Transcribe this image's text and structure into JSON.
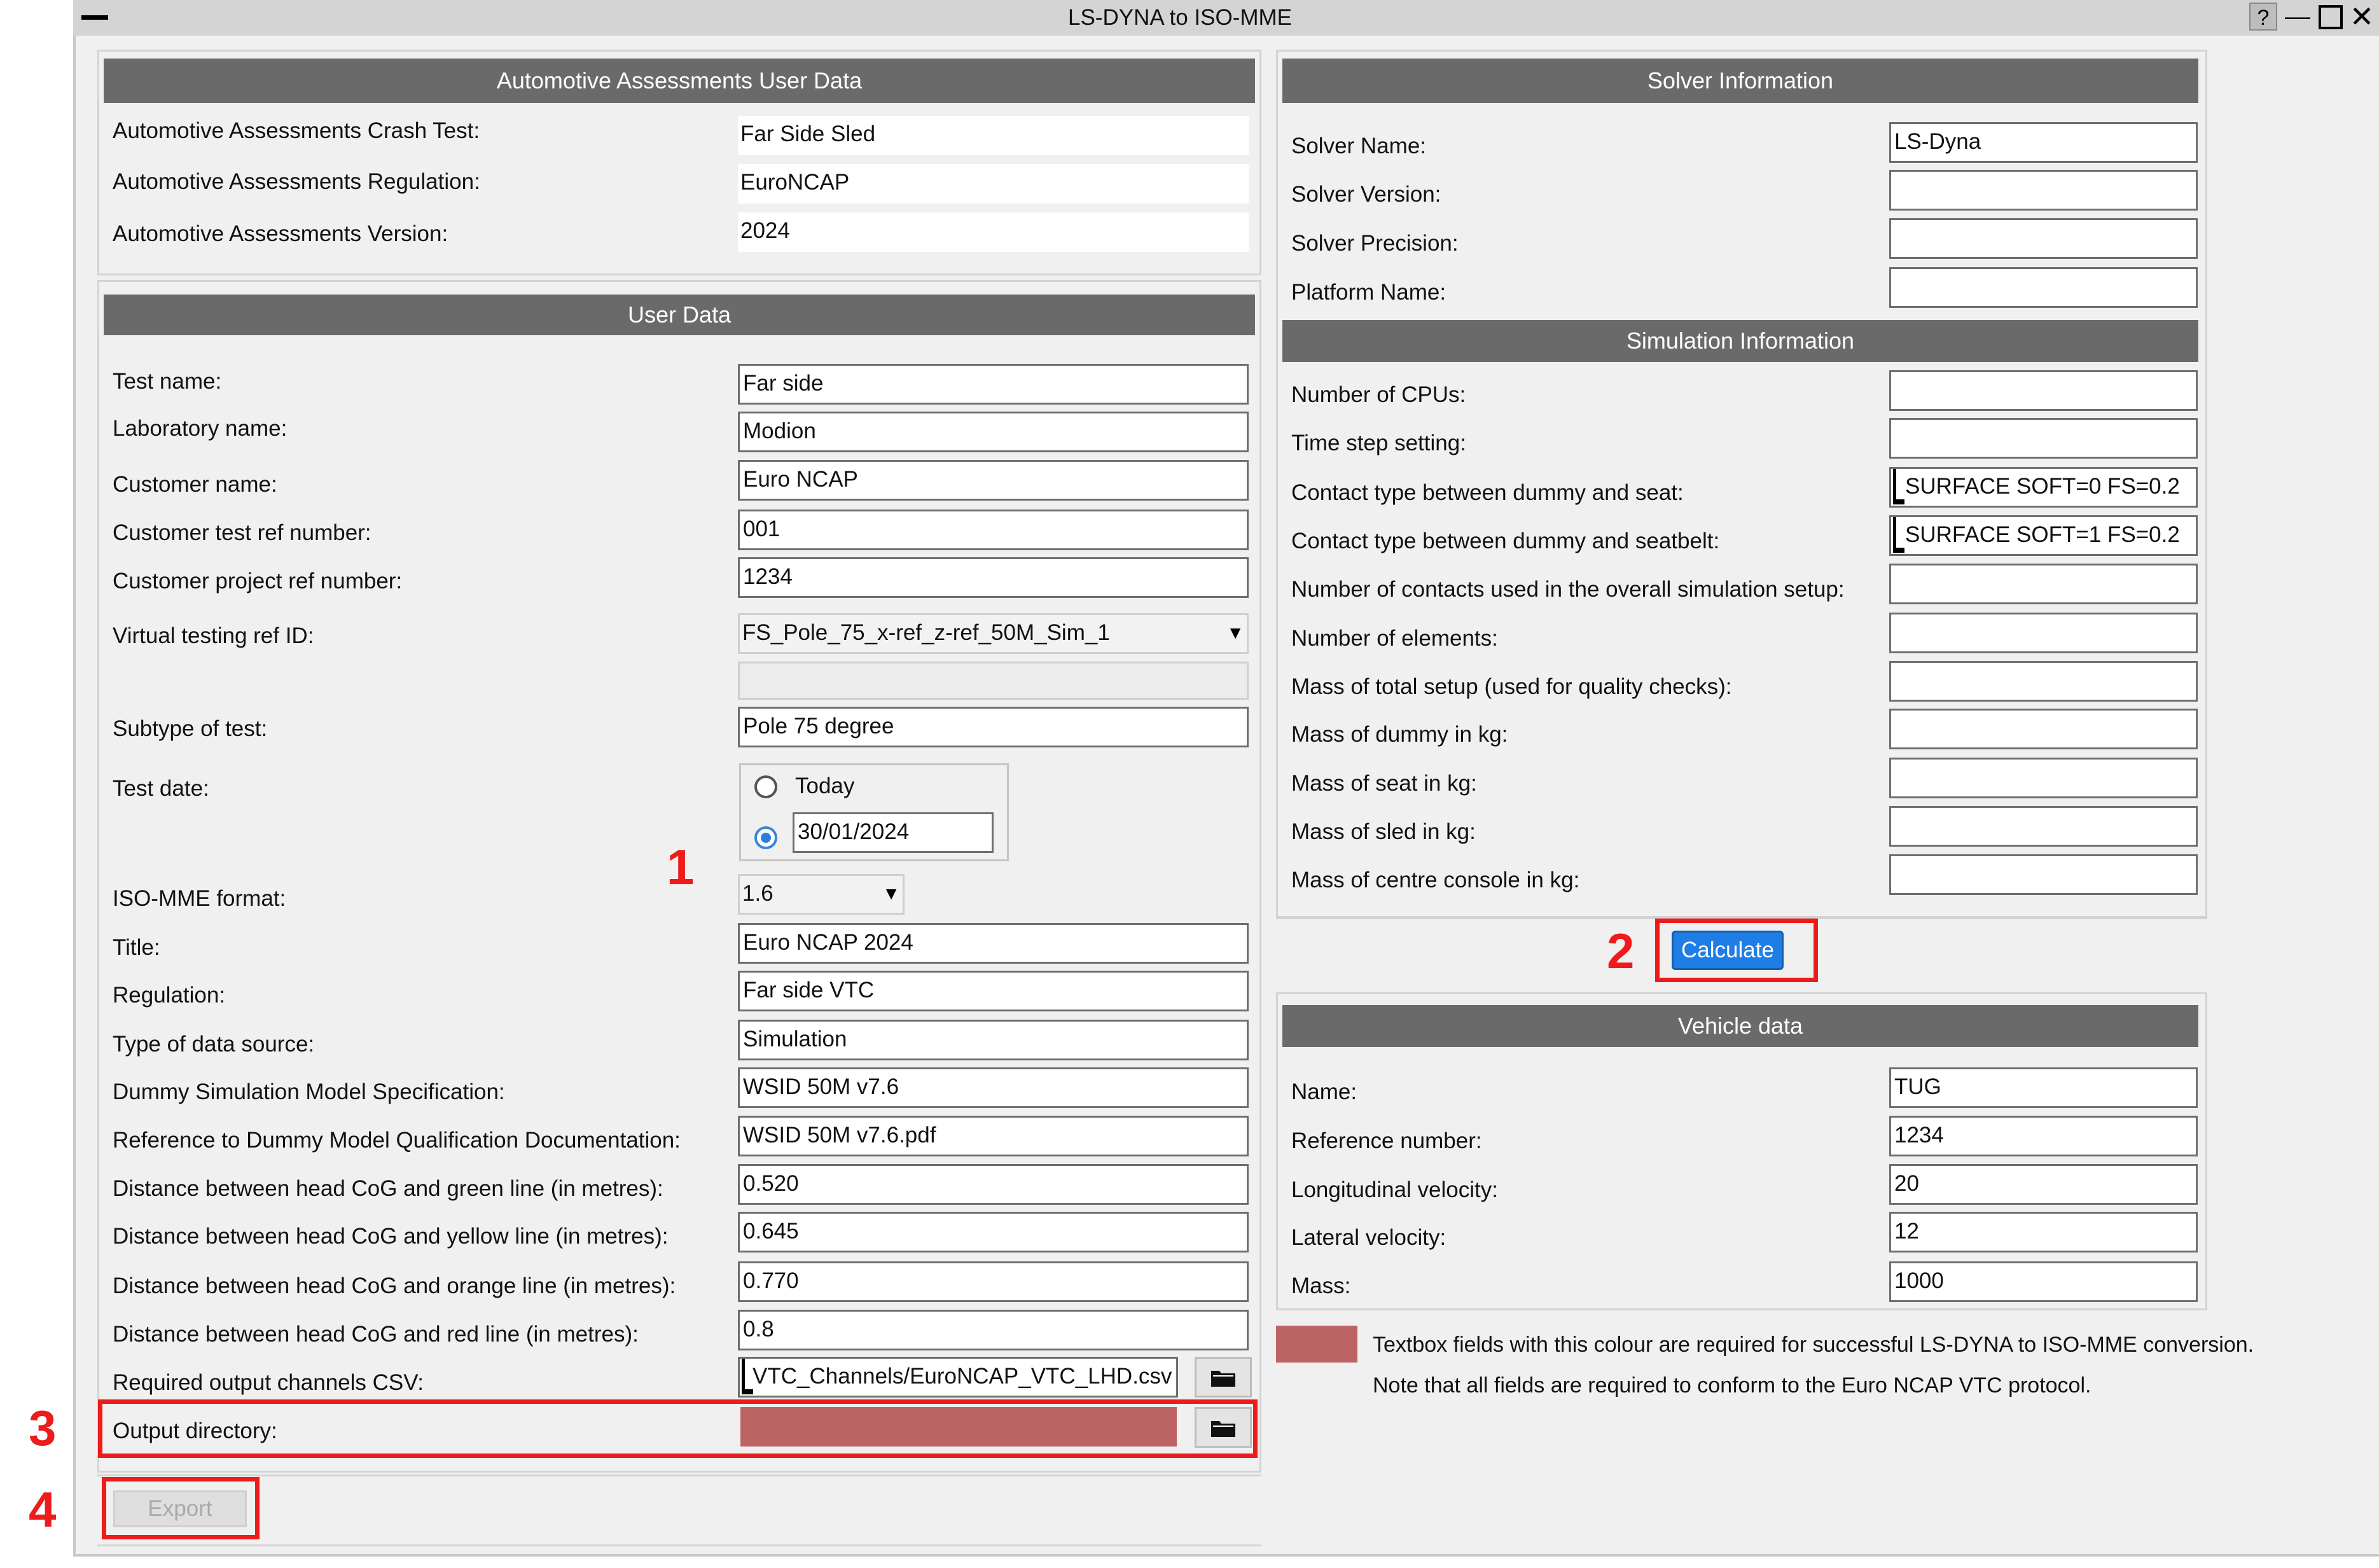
{
  "window": {
    "title": "LS-DYNA to ISO-MME",
    "help_glyph": "?",
    "minimize_glyph": "—",
    "maximize_glyph": "□",
    "close_glyph": "✕"
  },
  "assessments": {
    "header": "Automotive Assessments User Data",
    "crash_test_label": "Automotive Assessments Crash Test:",
    "crash_test_value": "Far Side Sled",
    "regulation_label": "Automotive Assessments Regulation:",
    "regulation_value": "EuroNCAP",
    "version_label": "Automotive Assessments Version:",
    "version_value": "2024"
  },
  "user_data": {
    "header": "User Data",
    "test_name_label": "Test name:",
    "test_name": "Far side",
    "lab_label": "Laboratory name:",
    "lab": "Modion",
    "customer_label": "Customer name:",
    "customer": "Euro NCAP",
    "cust_test_ref_label": "Customer test ref number:",
    "cust_test_ref": "001",
    "cust_proj_ref_label": "Customer project ref number:",
    "cust_proj_ref": "1234",
    "vt_ref_label": "Virtual testing ref ID:",
    "vt_ref": "FS_Pole_75_x-ref_z-ref_50M_Sim_1",
    "subtype_label": "Subtype of test:",
    "subtype": "Pole 75 degree",
    "test_date_label": "Test date:",
    "today_label": "Today",
    "date_value": "30/01/2024",
    "iso_format_label": "ISO-MME format:",
    "iso_format": "1.6",
    "title_label": "Title:",
    "title": "Euro NCAP 2024",
    "regulation_label": "Regulation:",
    "regulation": "Far side VTC",
    "source_label": "Type of data source:",
    "source": "Simulation",
    "dummy_spec_label": "Dummy Simulation Model Specification:",
    "dummy_spec": "WSID 50M v7.6",
    "dummy_doc_label": "Reference to Dummy Model Qualification Documentation:",
    "dummy_doc": "WSID 50M v7.6.pdf",
    "green_label": "Distance between head CoG and green line (in metres):",
    "green": "0.520",
    "yellow_label": "Distance between head CoG and yellow line (in metres):",
    "yellow": "0.645",
    "orange_label": "Distance between head CoG and orange line (in metres):",
    "orange": "0.770",
    "red_label": "Distance between head CoG and red line (in metres):",
    "red": "0.8",
    "channels_label": "Required output channels CSV:",
    "channels": "VTC_Channels/EuroNCAP_VTC_LHD.csv",
    "output_label": "Output directory:",
    "output": ""
  },
  "export_label": "Export",
  "solver": {
    "header": "Solver Information",
    "name_label": "Solver Name:",
    "name": "LS-Dyna",
    "version_label": "Solver Version:",
    "version": "",
    "precision_label": "Solver Precision:",
    "precision": "",
    "platform_label": "Platform Name:",
    "platform": ""
  },
  "simulation": {
    "header": "Simulation Information",
    "cpus_label": "Number of CPUs:",
    "cpus": "",
    "timestep_label": "Time step setting:",
    "timestep": "",
    "contact_seat_label": "Contact type between dummy and seat:",
    "contact_seat": "SURFACE SOFT=0 FS=0.2",
    "contact_belt_label": "Contact type between dummy and seatbelt:",
    "contact_belt": "SURFACE SOFT=1 FS=0.2",
    "num_contacts_label": "Number of contacts used in the overall simulation setup:",
    "num_contacts": "",
    "num_elements_label": "Number of elements:",
    "num_elements": "",
    "mass_total_label": "Mass of total setup (used for quality checks):",
    "mass_total": "",
    "mass_dummy_label": "Mass of dummy in kg:",
    "mass_dummy": "",
    "mass_seat_label": "Mass of seat in kg:",
    "mass_seat": "",
    "mass_sled_label": "Mass of sled in kg:",
    "mass_sled": "",
    "mass_console_label": "Mass of centre console in kg:",
    "mass_console": "",
    "calculate_label": "Calculate"
  },
  "vehicle": {
    "header": "Vehicle data",
    "name_label": "Name:",
    "name": "TUG",
    "ref_label": "Reference number:",
    "ref": "1234",
    "long_vel_label": "Longitudinal velocity:",
    "long_vel": "20",
    "lat_vel_label": "Lateral velocity:",
    "lat_vel": "12",
    "mass_label": "Mass:",
    "mass": "1000"
  },
  "legend": {
    "line1": "Textbox fields with this colour are required for successful LS-DYNA to ISO-MME conversion.",
    "line2": "Note that all fields are required to conform to the Euro NCAP VTC protocol.",
    "required_color": "#bc6464"
  },
  "annotations": {
    "n1": "1",
    "n2": "2",
    "n3": "3",
    "n4": "4",
    "color": "#ee1b1b"
  }
}
